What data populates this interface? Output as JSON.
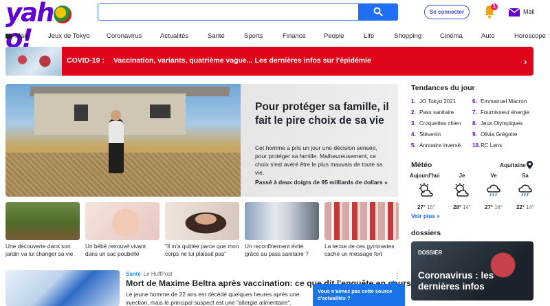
{
  "header": {
    "logo": "yahoo!",
    "search_placeholder": "",
    "signin_label": "Se connecter",
    "notif_count": "1",
    "mail_label": "Mail"
  },
  "nav": {
    "items": [
      "Mail",
      "Jeux de Tokyo",
      "Coronavirus",
      "Actualités",
      "Santé",
      "Sports",
      "Finance",
      "People",
      "Life",
      "Shopping",
      "Cinéma",
      "Auto",
      "Horoscope"
    ]
  },
  "banner": {
    "label": "COVID-19 :",
    "text": "Vaccination, variants, quatrième vague... Les dernières infos sur l'épidémie"
  },
  "hero": {
    "title": "Pour protéger sa famille, il fait le pire choix de sa vie",
    "summary": "Cet homme a pris un jour une décision sensée, pour protéger sa famille. Malheureusement, ce choix s'est avéré être le plus mauvais de toute sa vie.",
    "more": "Passé à deux doigts de 95 milliards de dollars »"
  },
  "thumbs": [
    {
      "caption": "Une découverte dans son jardin va lui changer sa vie"
    },
    {
      "caption": "Un bébé retrouvé vivant dans un sac poubelle"
    },
    {
      "caption": "\"Il m'a quittée parce que mon corps ne lui plaisait pas\""
    },
    {
      "caption": "Un reconfinement évité grâce au pass sanitaire ?"
    },
    {
      "caption": "La tenue de ces gymnastes cache un message fort"
    }
  ],
  "article": {
    "category": "Santé",
    "publisher": "Le HuffPost",
    "title": "Mort de Maxime Beltra après vaccination: ce que dit l'enquête en cours",
    "snippet": "Le jeune homme de 22 ans est décédé quelques heures après une injection, mais le principal suspect est une \"allergie alimentaire\".",
    "tooltip": "Vous n'aimez pas cette source d'actualités ?"
  },
  "trending": {
    "title": "Tendances du jour",
    "items": [
      {
        "n": "1.",
        "t": "JO Tokyo 2021"
      },
      {
        "n": "2.",
        "t": "Pass sanitaire"
      },
      {
        "n": "3.",
        "t": "Croquettes chien"
      },
      {
        "n": "4.",
        "t": "Stévenin"
      },
      {
        "n": "5.",
        "t": "Annuaire inversé"
      },
      {
        "n": "6.",
        "t": "Emmanuel Macron"
      },
      {
        "n": "7.",
        "t": "Fournisseur énergie"
      },
      {
        "n": "8.",
        "t": "Jeux Olympiques"
      },
      {
        "n": "9.",
        "t": "Olivia Grégoire"
      },
      {
        "n": "10.",
        "t": "RC Lens"
      }
    ]
  },
  "weather": {
    "title": "Météo",
    "location": "Aquitaine",
    "days": [
      {
        "label": "Aujourd'hui",
        "icon": "sun-cloud-icon",
        "hi": "27°",
        "lo": "15°"
      },
      {
        "label": "Je",
        "icon": "sun-cloud-icon",
        "hi": "28°",
        "lo": "14°"
      },
      {
        "label": "Ve",
        "icon": "rain-icon",
        "hi": "27°",
        "lo": "16°"
      },
      {
        "label": "Sa",
        "icon": "rain-icon",
        "hi": "22°",
        "lo": "14°"
      }
    ],
    "more": "Voir plus »"
  },
  "dossiers": {
    "title": "dossiers",
    "kicker": "DOSSIER",
    "card_title": "Coronavirus : les dernières infos"
  },
  "colors": {
    "brand": "#6001d2",
    "banner": "#e0051b",
    "search": "#1f6ff5",
    "link": "#0f69ff"
  }
}
